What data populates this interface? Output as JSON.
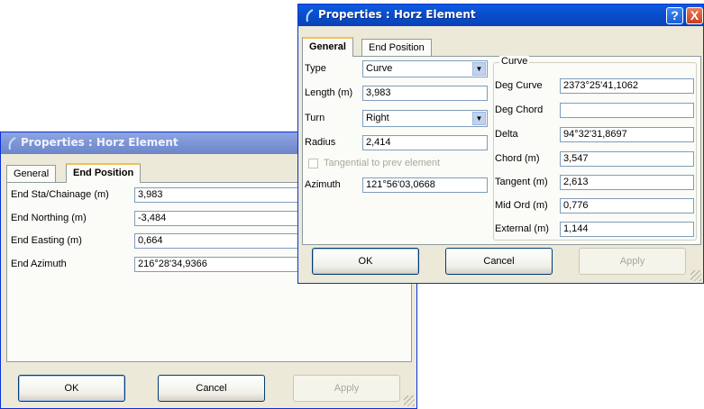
{
  "back_window": {
    "title": "Properties : Horz Element",
    "tabs": [
      "General",
      "End Position"
    ],
    "rows": [
      {
        "label": "End Sta/Chainage (m)",
        "value": "3,983"
      },
      {
        "label": "End Northing (m)",
        "value": "-3,484"
      },
      {
        "label": "End Easting (m)",
        "value": "0,664"
      },
      {
        "label": "End Azimuth",
        "value": "216°28'34,9366"
      }
    ],
    "buttons": {
      "ok": "OK",
      "cancel": "Cancel",
      "apply": "Apply"
    }
  },
  "front_window": {
    "title": "Properties : Horz Element",
    "help_glyph": "?",
    "close_glyph": "X",
    "tabs": [
      "General",
      "End Position"
    ],
    "left": {
      "type_label": "Type",
      "type_value": "Curve",
      "length_label": "Length (m)",
      "length_value": "3,983",
      "turn_label": "Turn",
      "turn_value": "Right",
      "radius_label": "Radius",
      "radius_value": "2,414",
      "tangential_label": "Tangential to prev element",
      "azimuth_label": "Azimuth",
      "azimuth_value": "121°56'03,0668"
    },
    "curve": {
      "group_title": "Curve",
      "rows": [
        {
          "label": "Deg Curve",
          "value": "2373°25'41,1062"
        },
        {
          "label": "Deg Chord",
          "value": ""
        },
        {
          "label": "Delta",
          "value": "94°32'31,8697"
        },
        {
          "label": "Chord (m)",
          "value": "3,547"
        },
        {
          "label": "Tangent (m)",
          "value": "2,613"
        },
        {
          "label": "Mid Ord (m)",
          "value": "0,776"
        },
        {
          "label": "External (m)",
          "value": "1,144"
        }
      ]
    },
    "buttons": {
      "ok": "OK",
      "cancel": "Cancel",
      "apply": "Apply"
    }
  }
}
